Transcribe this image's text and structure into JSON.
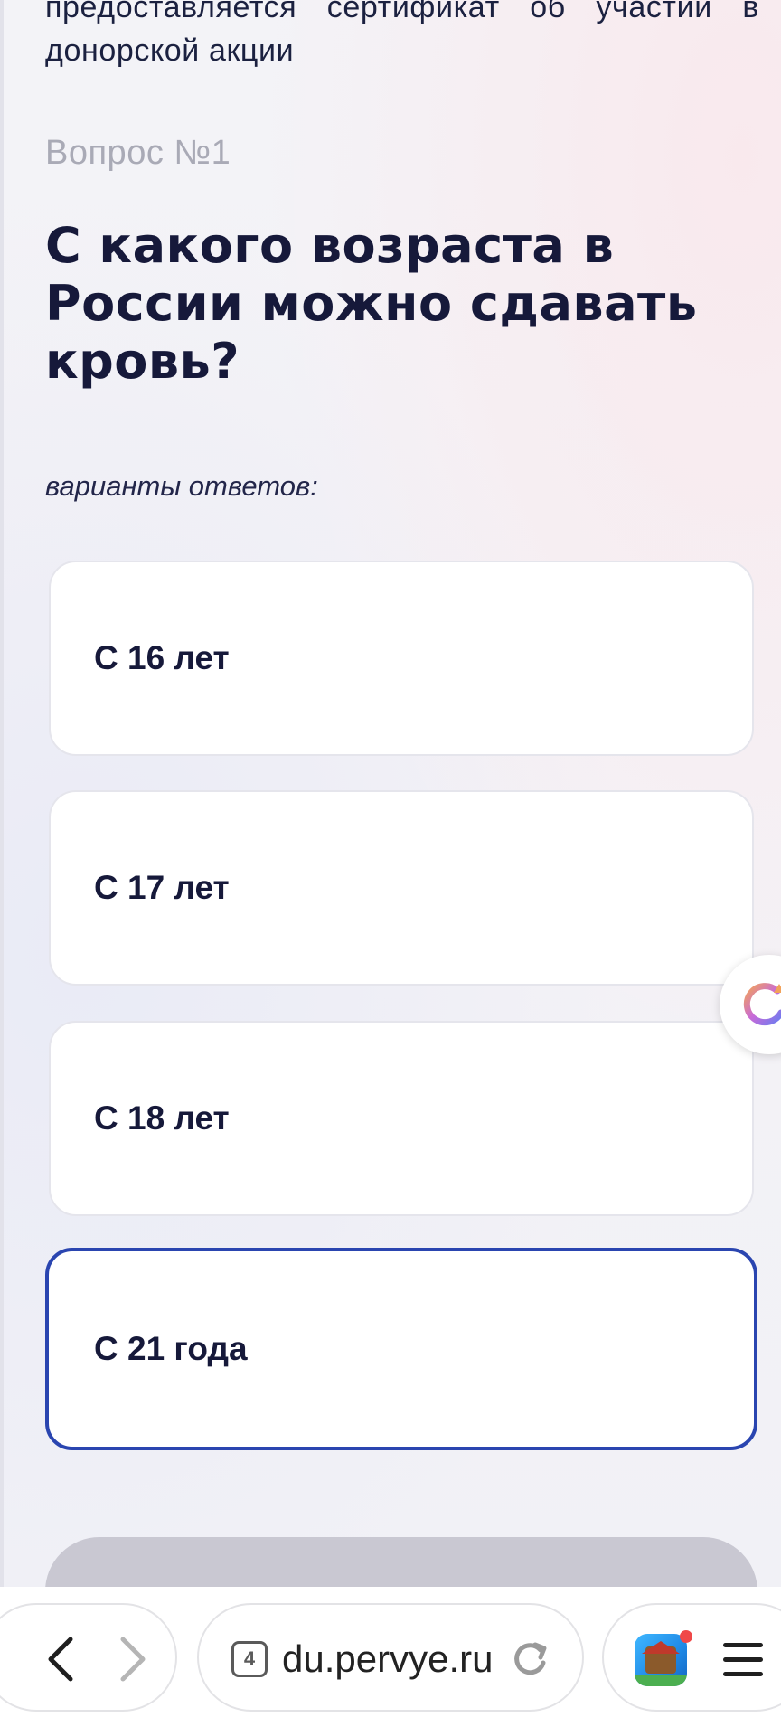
{
  "intro_text": "предоставляется сертификат об участии в донорской акции",
  "question": {
    "number_label": "Вопрос №1",
    "title": "С какого возраста в России можно сдавать кровь?"
  },
  "answers_label": "варианты ответов:",
  "options": [
    {
      "label": "С 16 лет",
      "selected": false
    },
    {
      "label": "С 17 лет",
      "selected": false
    },
    {
      "label": "С 18 лет",
      "selected": false
    },
    {
      "label": "С 21 года",
      "selected": true
    }
  ],
  "browser": {
    "tab_count": "4",
    "url": "du.pervye.ru",
    "icons": {
      "back": "chevron-left-icon",
      "forward": "chevron-right-icon",
      "reload": "reload-icon",
      "app": "game-app-icon",
      "menu": "hamburger-menu-icon"
    }
  },
  "colors": {
    "selected_border": "#2a45b0",
    "title_text": "#16193a",
    "muted_text": "#a9aab6",
    "submit_disabled": "#c9c8d2",
    "notification": "#f04848"
  }
}
